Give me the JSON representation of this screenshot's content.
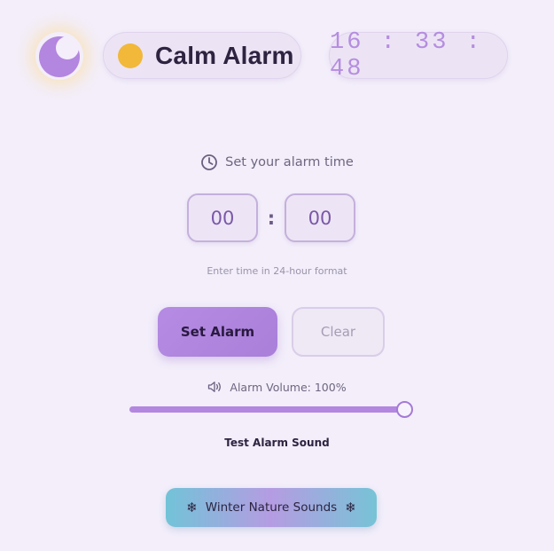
{
  "header": {
    "theme_toggle_icon": "moon-icon",
    "title": "Calm Alarm",
    "title_icon": "sun-icon",
    "clock": "16:33:48"
  },
  "alarm": {
    "prompt": "Set your alarm time",
    "prompt_icon": "clock-icon",
    "hours": "00",
    "minutes": "00",
    "separator": ":",
    "hint": "Enter time in 24-hour format",
    "set_label": "Set Alarm",
    "clear_label": "Clear"
  },
  "volume": {
    "label": "Alarm Volume: 100%",
    "icon": "speaker-icon",
    "level": 1.0,
    "test_label": "Test Alarm Sound"
  },
  "nature": {
    "label": "Winter Nature Sounds",
    "icon": "snowflake-icon"
  },
  "colors": {
    "background": "#f3eefa",
    "accent": "#b387e0",
    "clock_text": "#b58de0",
    "sun": "#f1b83a",
    "nature_gradient_start": "#72c3d8",
    "nature_gradient_mid": "#b59ce2"
  }
}
